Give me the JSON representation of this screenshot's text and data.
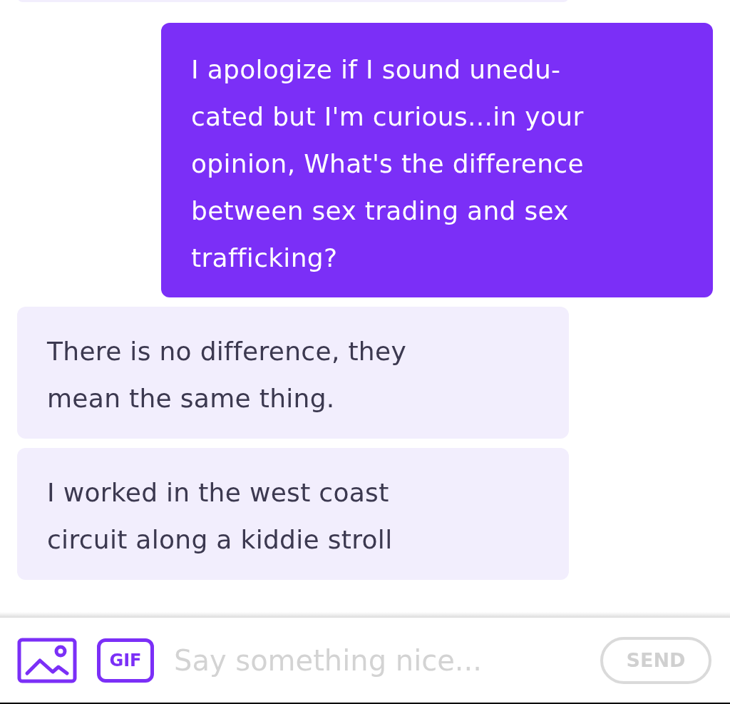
{
  "messages": [
    {
      "kind": "received"
    },
    {
      "kind": "sent",
      "text": "I apologize if I sound unedu-\ncated but I'm curious...in your\nopinion, What's the difference\nbetween sex trading and sex\ntrafficking?"
    },
    {
      "kind": "received",
      "text": "There is no difference, they\nmean the same thing."
    },
    {
      "kind": "received",
      "text": "I worked in the west coast\ncircuit along a kiddie stroll"
    }
  ],
  "composer": {
    "gif_label": "GIF",
    "placeholder": "Say something nice...",
    "send": {
      "label": "SEND",
      "disabled": true
    }
  }
}
